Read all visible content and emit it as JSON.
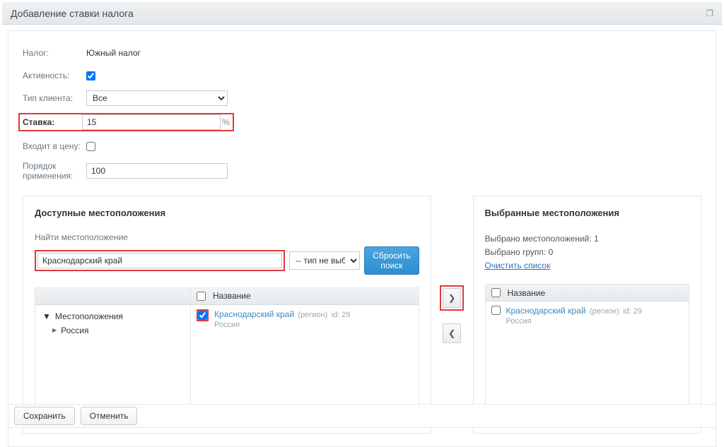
{
  "window": {
    "title": "Добавление ставки налога"
  },
  "form": {
    "tax_label": "Налог:",
    "tax_value": "Южный налог",
    "activity_label": "Активность:",
    "client_type_label": "Тип клиента:",
    "client_type_value": "Все",
    "rate_label": "Ставка:",
    "rate_value": "15",
    "rate_pct": "%",
    "included_label": "Входит в цену:",
    "order_label": "Порядок применения:",
    "order_value": "100"
  },
  "available": {
    "title": "Доступные местоположения",
    "search_label": "Найти местоположение",
    "search_value": "Краснодарский край",
    "type_select": "-- тип не выбран",
    "reset_button": "Сбросить поиск",
    "tree_root": "Местоположения",
    "tree_child": "Россия",
    "grid_header_name": "Название",
    "result": {
      "name": "Краснодарский край",
      "type": "(регион)",
      "id": "id: 29",
      "country": "Россия"
    }
  },
  "selected": {
    "title": "Выбранные местоположения",
    "count_locations_label": "Выбрано местоположений:",
    "count_locations_value": "1",
    "count_groups_label": "Выбрано групп:",
    "count_groups_value": "0",
    "clear_link": "Очистить список",
    "grid_header_name": "Название",
    "result": {
      "name": "Краснодарский край",
      "type": "(регион)",
      "id": "id: 29",
      "country": "Россия"
    }
  },
  "footer": {
    "save": "Сохранить",
    "cancel": "Отменить"
  }
}
